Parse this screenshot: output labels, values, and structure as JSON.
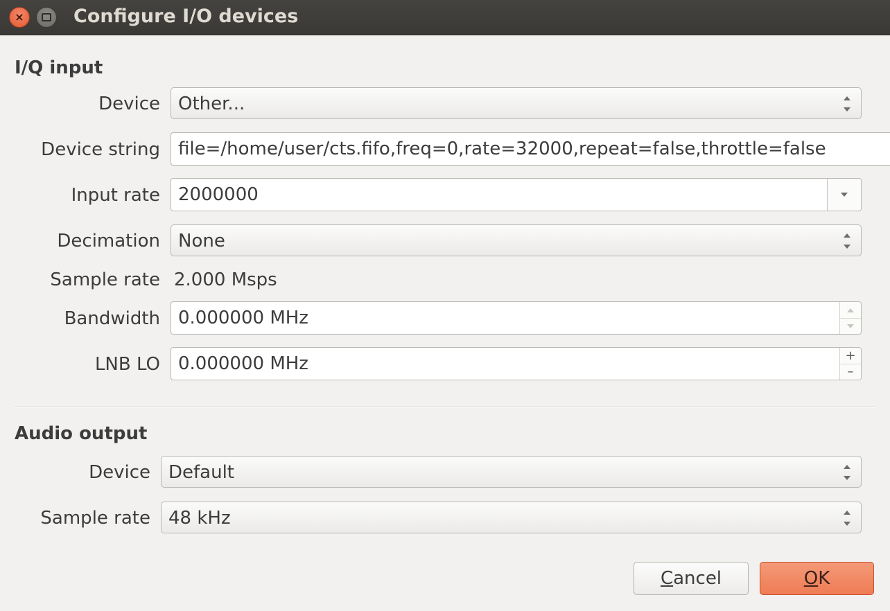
{
  "window": {
    "title": "Configure I/O devices"
  },
  "iq_input": {
    "section_title": "I/Q input",
    "device_label": "Device",
    "device_value": "Other...",
    "device_string_label": "Device string",
    "device_string_value": "file=/home/user/cts.fifo,freq=0,rate=32000,repeat=false,throttle=false",
    "input_rate_label": "Input rate",
    "input_rate_value": "2000000",
    "decimation_label": "Decimation",
    "decimation_value": "None",
    "sample_rate_label": "Sample rate",
    "sample_rate_value": "2.000 Msps",
    "bandwidth_label": "Bandwidth",
    "bandwidth_value": "0.000000 MHz",
    "lnb_lo_label": "LNB LO",
    "lnb_lo_value": "0.000000 MHz"
  },
  "audio_output": {
    "section_title": "Audio output",
    "device_label": "Device",
    "device_value": "Default",
    "sample_rate_label": "Sample rate",
    "sample_rate_value": "48 kHz"
  },
  "buttons": {
    "cancel_mnemonic": "C",
    "cancel_rest": "ancel",
    "ok_mnemonic": "O",
    "ok_rest": "K"
  },
  "colors": {
    "titlebar": "#3d3c38",
    "background": "#f2f1f0",
    "ok_button": "#f08a64",
    "close_button": "#e96a43"
  }
}
